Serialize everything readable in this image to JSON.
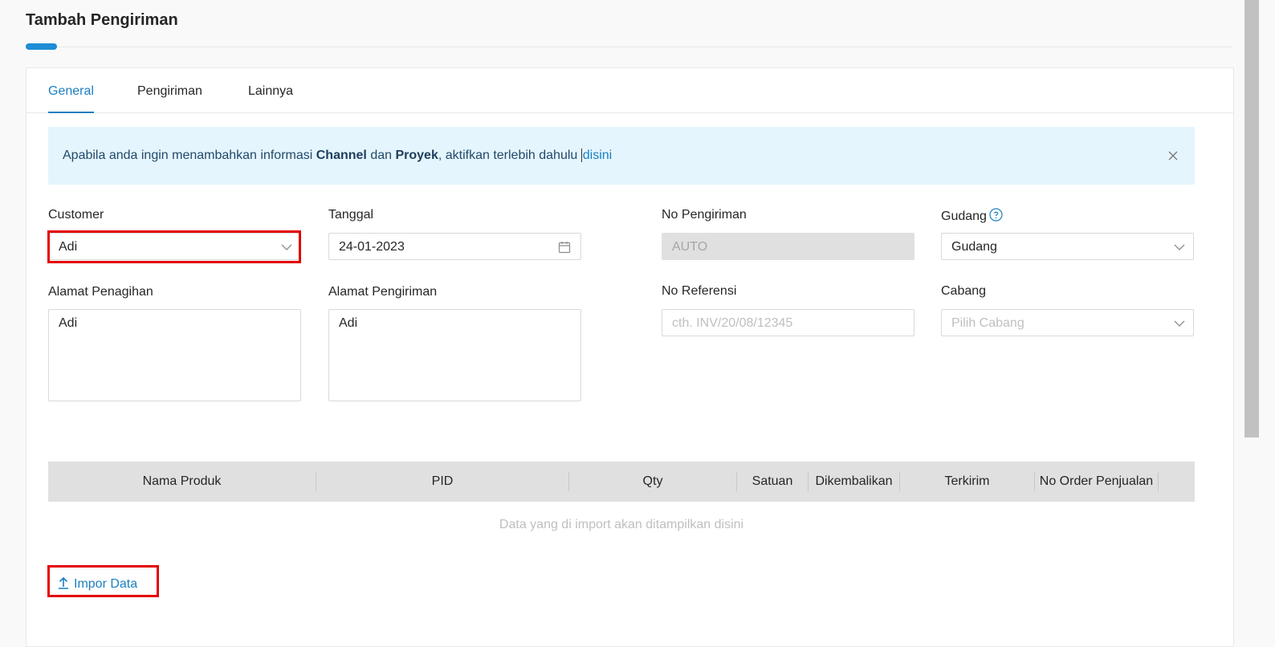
{
  "page": {
    "title": "Tambah Pengiriman"
  },
  "tabs": [
    {
      "label": "General",
      "active": true
    },
    {
      "label": "Pengiriman",
      "active": false
    },
    {
      "label": "Lainnya",
      "active": false
    }
  ],
  "alert": {
    "text_1": "Apabila anda ingin menambahkan informasi ",
    "bold_1": "Channel",
    "text_2": " dan ",
    "bold_2": "Proyek",
    "text_3": ", aktifkan terlebih dahulu ",
    "link": "disini"
  },
  "form": {
    "customer": {
      "label": "Customer",
      "value": "Adi"
    },
    "tanggal": {
      "label": "Tanggal",
      "value": "24-01-2023"
    },
    "no_pengiriman": {
      "label": "No Pengiriman",
      "value": "AUTO"
    },
    "gudang": {
      "label": "Gudang",
      "value": "Gudang"
    },
    "alamat_penagihan": {
      "label": "Alamat Penagihan",
      "value": "Adi"
    },
    "alamat_pengiriman": {
      "label": "Alamat Pengiriman",
      "value": "Adi"
    },
    "no_referensi": {
      "label": "No Referensi",
      "placeholder": "cth. INV/20/08/12345"
    },
    "cabang": {
      "label": "Cabang",
      "placeholder": "Pilih Cabang"
    }
  },
  "table": {
    "columns": [
      "Nama Produk",
      "PID",
      "Qty",
      "Satuan",
      "Dikembalikan",
      "Terkirim",
      "No Order Penjualan"
    ],
    "empty_text": "Data yang di import akan ditampilkan disini"
  },
  "actions": {
    "import_label": "Impor Data"
  },
  "colors": {
    "accent": "#1a7fc1",
    "highlight": "#e30000",
    "alert_bg": "#e5f5fd"
  },
  "icons": [
    "close-icon",
    "chevron-down-icon",
    "calendar-icon",
    "help-icon",
    "upload-icon"
  ]
}
